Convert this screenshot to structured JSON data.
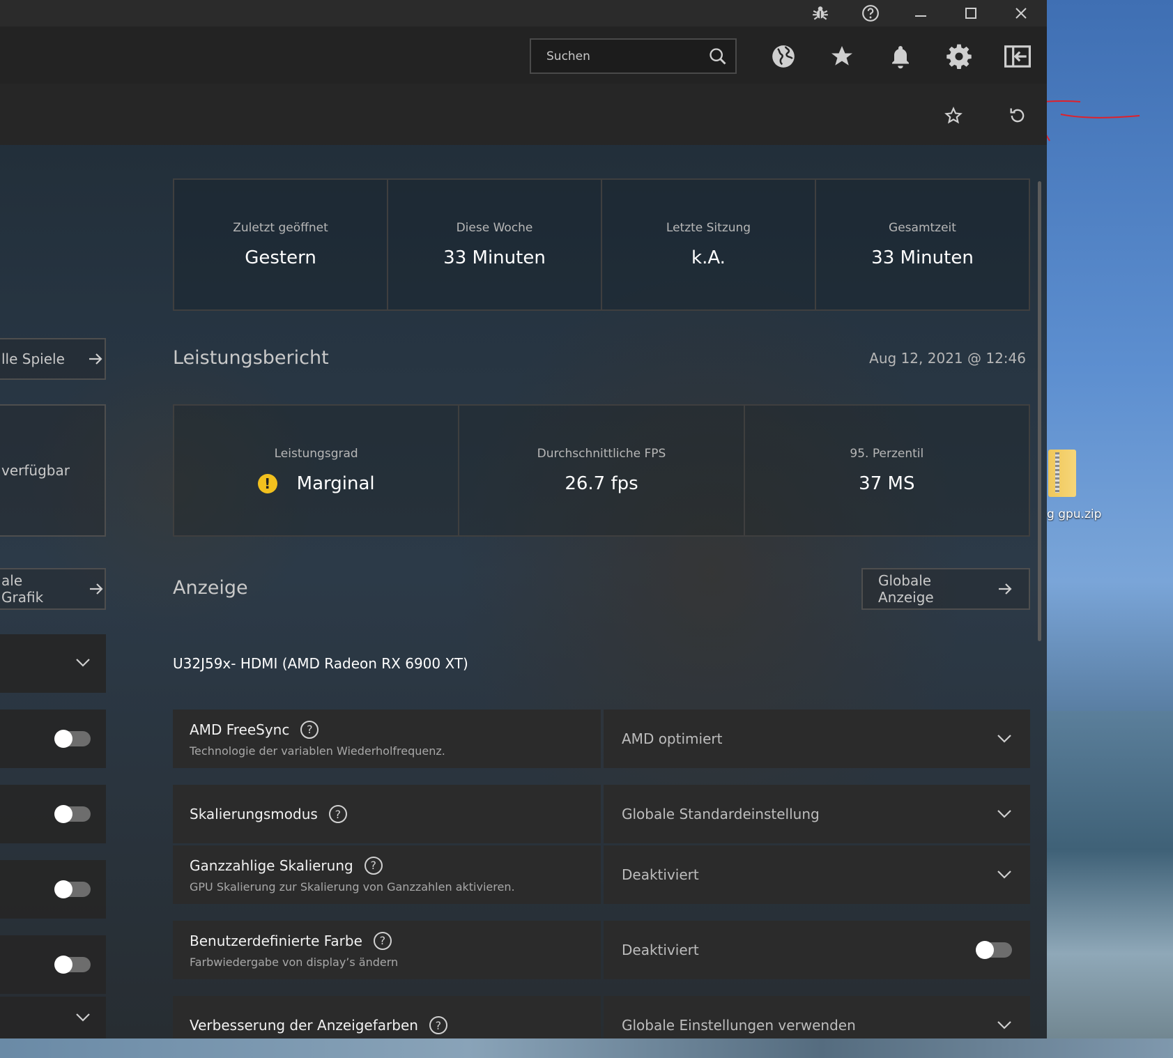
{
  "window": {
    "controls": [
      "bug-icon",
      "help-icon",
      "minimize-icon",
      "maximize-icon",
      "close-icon"
    ]
  },
  "toolbar": {
    "search_placeholder": "Suchen",
    "icons": [
      "globe-icon",
      "star-icon",
      "bell-icon",
      "gear-icon",
      "sidebar-collapse-icon"
    ]
  },
  "subbar": {
    "icons": [
      "favorite-outline-icon",
      "reset-icon"
    ]
  },
  "stats": [
    {
      "label": "Zuletzt geöffnet",
      "value": "Gestern"
    },
    {
      "label": "Diese Woche",
      "value": "33 Minuten"
    },
    {
      "label": "Letzte Sitzung",
      "value": "k.A."
    },
    {
      "label": "Gesamtzeit",
      "value": "33 Minuten"
    }
  ],
  "performance": {
    "title": "Leistungsbericht",
    "date": "Aug 12, 2021 @ 12:46",
    "cells": [
      {
        "label": "Leistungsgrad",
        "value": "Marginal",
        "status_color": "#f2c01e"
      },
      {
        "label": "Durchschnittliche FPS",
        "value": "26.7 fps"
      },
      {
        "label": "95. Perzentil",
        "value": "37 MS"
      }
    ]
  },
  "left_sidebar": {
    "all_games": "lle Spiele",
    "unavailable": "verfügbar",
    "global_graphics": "ale Grafik"
  },
  "display": {
    "title": "Anzeige",
    "global_button": "Globale Anzeige",
    "monitor": "U32J59x- HDMI (AMD Radeon RX 6900 XT)",
    "settings": [
      {
        "title": "AMD FreeSync",
        "desc": "Technologie der variablen Wiederholfrequenz.",
        "value": "AMD optimiert",
        "control": "dropdown"
      },
      {
        "title": "Skalierungsmodus",
        "desc": "",
        "value": "Globale Standardeinstellung",
        "control": "dropdown"
      },
      {
        "title": "Ganzzahlige Skalierung",
        "desc": "GPU Skalierung zur Skalierung von Ganzzahlen aktivieren.",
        "value": "Deaktiviert",
        "control": "dropdown"
      },
      {
        "title": "Benutzerdefinierte Farbe",
        "desc": "Farbwiedergabe von display’s ändern",
        "value": "Deaktiviert",
        "control": "toggle",
        "toggle_on": false
      },
      {
        "title": "Verbesserung der Anzeigefarben",
        "desc": "",
        "value": "Globale Einstellungen verwenden",
        "control": "dropdown"
      }
    ]
  },
  "desktop": {
    "file_label": "g gpu.zip"
  },
  "colors": {
    "accent_warning": "#f2c01e",
    "panel": "#2b2b2b",
    "annotation": "#e0202a"
  }
}
